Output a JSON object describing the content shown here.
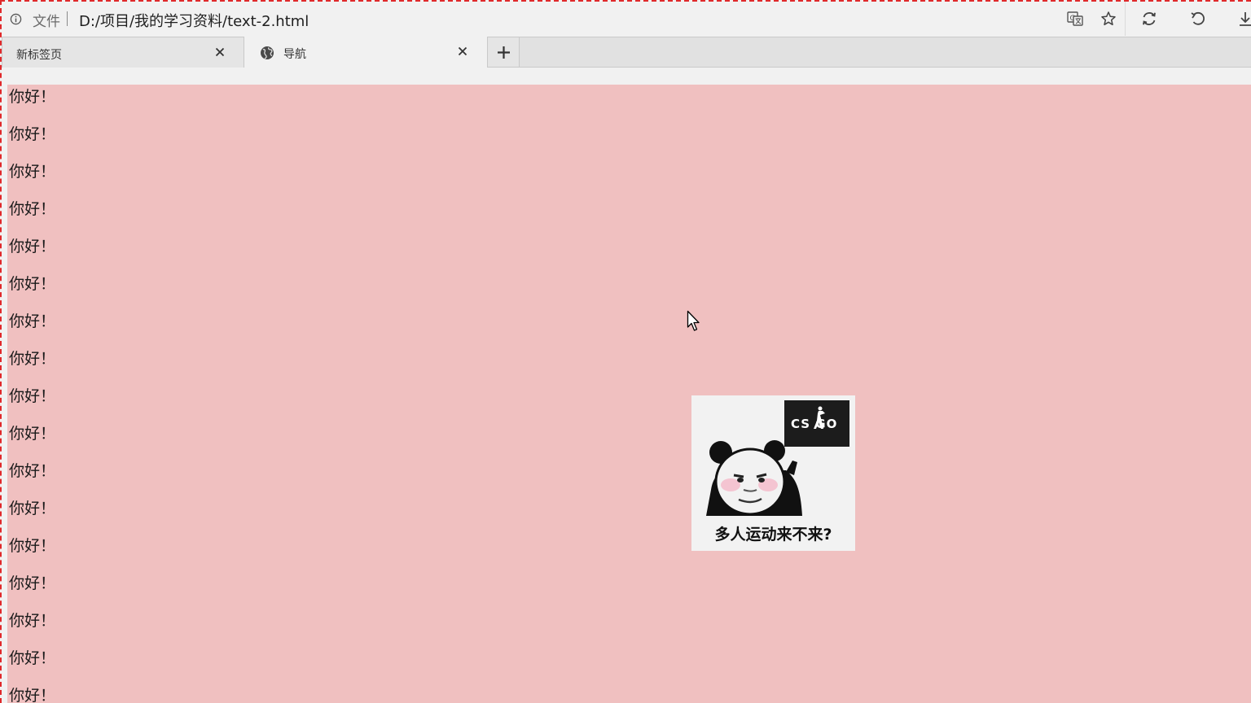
{
  "browser": {
    "scheme_label": "文件",
    "url": "D:/项目/我的学习资料/text-2.html",
    "toolbar_icons": [
      "translate-icon",
      "star-icon",
      "sync-icon",
      "undo-icon",
      "download-icon"
    ]
  },
  "tabs": [
    {
      "label": "新标签页",
      "icon": null
    },
    {
      "label": "导航",
      "icon": "globe-icon"
    }
  ],
  "page": {
    "background": "#f0c0c0",
    "greetings": [
      "你好！",
      "你好！",
      "你好！",
      "你好！",
      "你好！",
      "你好！",
      "你好！",
      "你好！",
      "你好！",
      "你好！",
      "你好！",
      "你好！",
      "你好！",
      "你好！",
      "你好！",
      "你好！",
      "你好！"
    ],
    "sticker": {
      "caption": "多人运动来不来?",
      "badge_text": "CS GO"
    }
  }
}
